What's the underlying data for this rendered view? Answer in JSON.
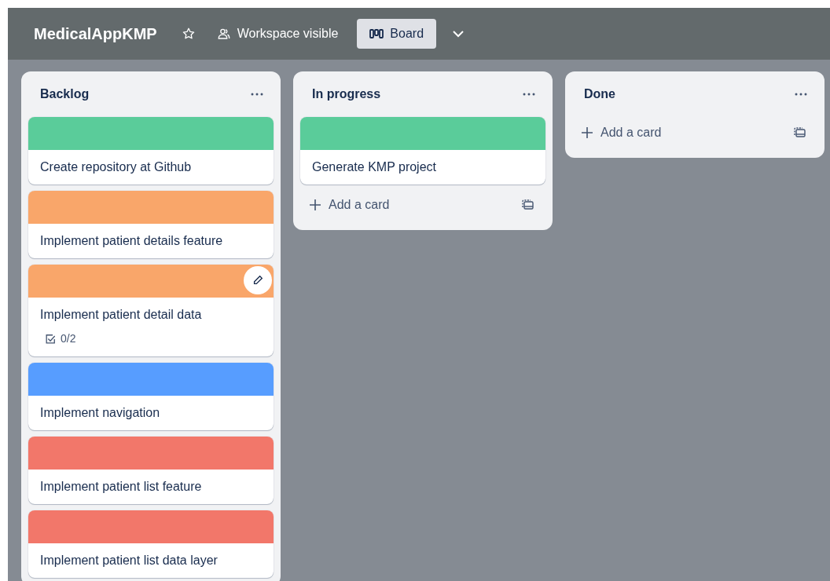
{
  "board": {
    "title": "MedicalAppKMP",
    "starred": false,
    "visibility": "Workspace visible",
    "view": "Board"
  },
  "lists": [
    {
      "title": "Backlog",
      "cards": [
        {
          "title": "Create repository at Github",
          "color": "#5acc9a",
          "edit_button": false
        },
        {
          "title": "Implement patient details feature",
          "color": "#f9a66a",
          "edit_button": false
        },
        {
          "title": "Implement patient detail data",
          "color": "#f9a66a",
          "edit_button": true,
          "checklist": "0/2"
        },
        {
          "title": "Implement navigation",
          "color": "#579dff",
          "edit_button": false
        },
        {
          "title": "Implement patient list feature",
          "color": "#f2776a",
          "edit_button": false
        },
        {
          "title": "Implement patient list data layer",
          "color": "#f2776a",
          "edit_button": false
        }
      ]
    },
    {
      "title": "In progress",
      "add_label": "Add a card",
      "cards": [
        {
          "title": "Generate KMP project",
          "color": "#5acc9a",
          "edit_button": false
        }
      ]
    },
    {
      "title": "Done",
      "add_label": "Add a card"
    }
  ]
}
